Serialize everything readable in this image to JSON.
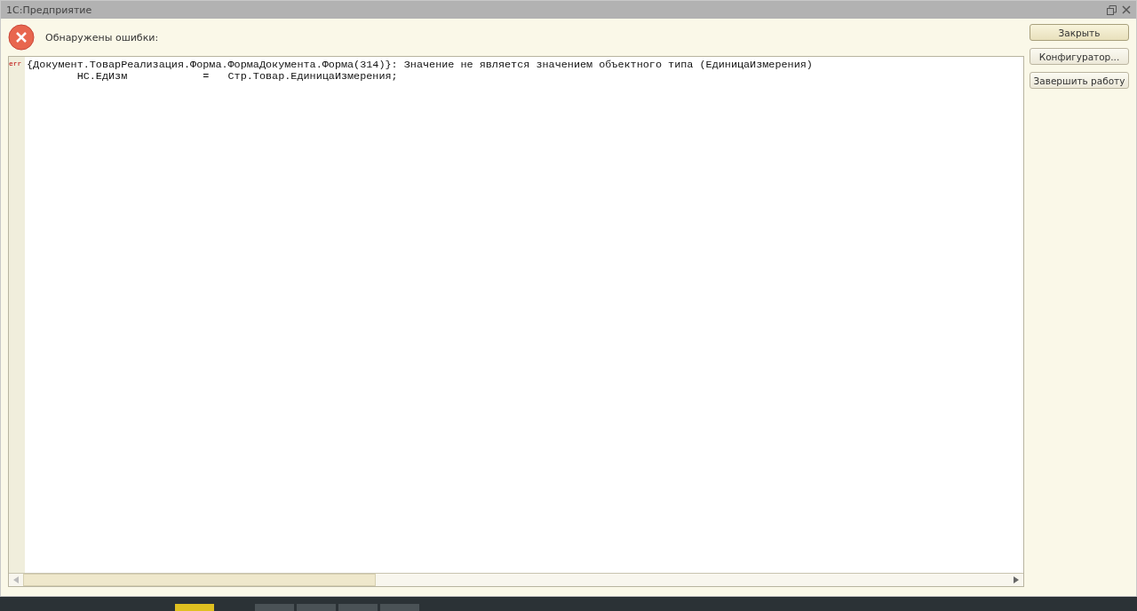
{
  "window": {
    "title": "1С:Предприятие"
  },
  "header": {
    "message": "Обнаружены ошибки:"
  },
  "lines": [
    {
      "marker": "err",
      "text": "{Документ.ТоварРеализация.Форма.ФормаДокумента.Форма(314)}: Значение не является значением объектного типа (ЕдиницаИзмерения)"
    },
    {
      "text": "        НС.ЕдИзм            =   Стр.Товар.ЕдиницаИзмерения;"
    }
  ],
  "buttons": [
    {
      "label": "Закрыть",
      "default": true
    },
    {
      "label": "Конфигуратор...",
      "default": false
    },
    {
      "label": "Завершить работу",
      "default": false
    }
  ]
}
